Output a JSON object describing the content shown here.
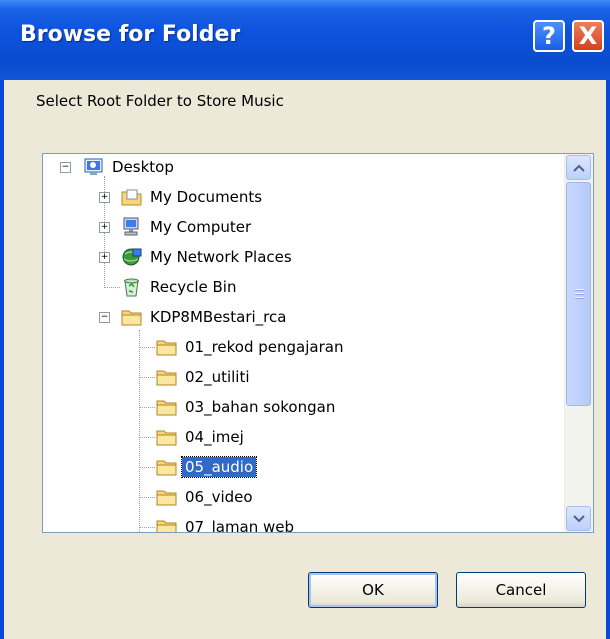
{
  "dialog": {
    "title": "Browse for Folder",
    "help_symbol": "?",
    "close_symbol": "X",
    "prompt": "Select Root Folder to Store Music"
  },
  "tree": {
    "items": [
      {
        "label": "Desktop",
        "icon": "desktop-icon",
        "expander": "−"
      },
      {
        "label": "My Documents",
        "icon": "my-documents-icon",
        "expander": "+"
      },
      {
        "label": "My Computer",
        "icon": "my-computer-icon",
        "expander": "+"
      },
      {
        "label": "My Network Places",
        "icon": "network-places-icon",
        "expander": "+"
      },
      {
        "label": "Recycle Bin",
        "icon": "recycle-bin-icon"
      },
      {
        "label": "KDP8MBestari_rca",
        "icon": "folder-icon",
        "expander": "−"
      },
      {
        "label": "01_rekod pengajaran",
        "icon": "folder-icon"
      },
      {
        "label": "02_utiliti",
        "icon": "folder-icon"
      },
      {
        "label": "03_bahan sokongan",
        "icon": "folder-icon"
      },
      {
        "label": "04_imej",
        "icon": "folder-icon"
      },
      {
        "label": "05_audio",
        "icon": "folder-icon",
        "selected": true
      },
      {
        "label": "06_video",
        "icon": "folder-icon"
      },
      {
        "label": "07_laman web",
        "icon": "folder-icon"
      }
    ]
  },
  "scrollbar": {
    "up_icon": "chevron-up-icon",
    "down_icon": "chevron-down-icon"
  },
  "buttons": {
    "ok": "OK",
    "cancel": "Cancel"
  },
  "colors": {
    "titlebar": "#0a4ccf",
    "dialog_bg": "#ece9d8",
    "selection": "#316ac5"
  }
}
